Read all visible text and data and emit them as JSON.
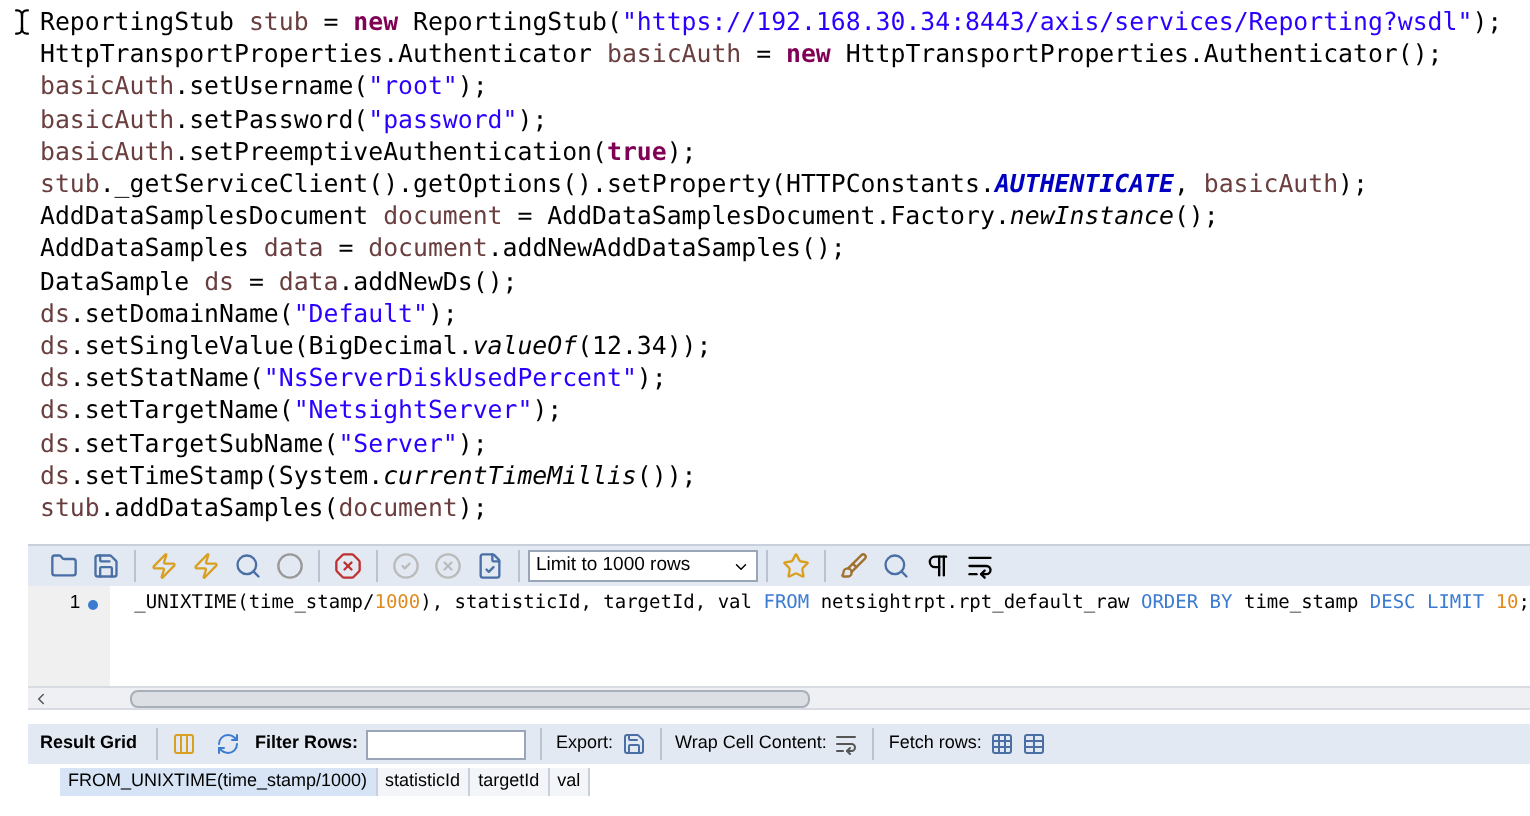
{
  "code_lines": [
    [
      {
        "t": "ReportingStub ",
        "kind": "plain"
      },
      {
        "t": "stub",
        "kind": "var"
      },
      {
        "t": " = ",
        "kind": "plain"
      },
      {
        "t": "new",
        "kind": "kw"
      },
      {
        "t": " ReportingStub(",
        "kind": "plain"
      },
      {
        "t": "\"https://192.168.30.34:8443/axis/services/Reporting?wsdl\"",
        "kind": "str"
      },
      {
        "t": ");",
        "kind": "plain"
      }
    ],
    [
      {
        "t": "HttpTransportProperties.Authenticator ",
        "kind": "plain"
      },
      {
        "t": "basicAuth",
        "kind": "var"
      },
      {
        "t": " = ",
        "kind": "plain"
      },
      {
        "t": "new",
        "kind": "kw"
      },
      {
        "t": " HttpTransportProperties.Authenticator();",
        "kind": "plain"
      }
    ],
    [
      {
        "t": "basicAuth",
        "kind": "var"
      },
      {
        "t": ".setUsername(",
        "kind": "plain"
      },
      {
        "t": "\"root\"",
        "kind": "str"
      },
      {
        "t": ");",
        "kind": "plain"
      }
    ],
    [
      {
        "t": "basicAuth",
        "kind": "var"
      },
      {
        "t": ".setPassword(",
        "kind": "plain"
      },
      {
        "t": "\"password\"",
        "kind": "str"
      },
      {
        "t": ");",
        "kind": "plain"
      }
    ],
    [
      {
        "t": "basicAuth",
        "kind": "var"
      },
      {
        "t": ".setPreemptiveAuthentication(",
        "kind": "plain"
      },
      {
        "t": "true",
        "kind": "kw"
      },
      {
        "t": ");",
        "kind": "plain"
      }
    ],
    [
      {
        "t": "stub",
        "kind": "var"
      },
      {
        "t": "._getServiceClient().getOptions().setProperty(HTTPConstants.",
        "kind": "plain"
      },
      {
        "t": "AUTHENTICATE",
        "kind": "const"
      },
      {
        "t": ", ",
        "kind": "plain"
      },
      {
        "t": "basicAuth",
        "kind": "var"
      },
      {
        "t": ");",
        "kind": "plain"
      }
    ],
    [
      {
        "t": "AddDataSamplesDocument ",
        "kind": "plain"
      },
      {
        "t": "document",
        "kind": "var"
      },
      {
        "t": " = AddDataSamplesDocument.Factory.",
        "kind": "plain"
      },
      {
        "t": "newInstance",
        "kind": "static"
      },
      {
        "t": "();",
        "kind": "plain"
      }
    ],
    [
      {
        "t": "AddDataSamples ",
        "kind": "plain"
      },
      {
        "t": "data",
        "kind": "var"
      },
      {
        "t": " = ",
        "kind": "plain"
      },
      {
        "t": "document",
        "kind": "var"
      },
      {
        "t": ".addNewAddDataSamples();",
        "kind": "plain"
      }
    ],
    [
      {
        "t": "DataSample ",
        "kind": "plain"
      },
      {
        "t": "ds",
        "kind": "var"
      },
      {
        "t": " = ",
        "kind": "plain"
      },
      {
        "t": "data",
        "kind": "var"
      },
      {
        "t": ".addNewDs();",
        "kind": "plain"
      }
    ],
    [
      {
        "t": "ds",
        "kind": "var"
      },
      {
        "t": ".setDomainName(",
        "kind": "plain"
      },
      {
        "t": "\"Default\"",
        "kind": "str"
      },
      {
        "t": ");",
        "kind": "plain"
      }
    ],
    [
      {
        "t": "ds",
        "kind": "var"
      },
      {
        "t": ".setSingleValue(BigDecimal.",
        "kind": "plain"
      },
      {
        "t": "valueOf",
        "kind": "static"
      },
      {
        "t": "(12.34));",
        "kind": "plain"
      }
    ],
    [
      {
        "t": "ds",
        "kind": "var"
      },
      {
        "t": ".setStatName(",
        "kind": "plain"
      },
      {
        "t": "\"NsServerDiskUsedPercent\"",
        "kind": "str"
      },
      {
        "t": ");",
        "kind": "plain"
      }
    ],
    [
      {
        "t": "ds",
        "kind": "var"
      },
      {
        "t": ".setTargetName(",
        "kind": "plain"
      },
      {
        "t": "\"NetsightServer\"",
        "kind": "str"
      },
      {
        "t": ");",
        "kind": "plain"
      }
    ],
    [
      {
        "t": "ds",
        "kind": "var"
      },
      {
        "t": ".setTargetSubName(",
        "kind": "plain"
      },
      {
        "t": "\"Server\"",
        "kind": "str"
      },
      {
        "t": ");",
        "kind": "plain"
      }
    ],
    [
      {
        "t": "ds",
        "kind": "var"
      },
      {
        "t": ".setTimeStamp(System.",
        "kind": "plain"
      },
      {
        "t": "currentTimeMillis",
        "kind": "static"
      },
      {
        "t": "());",
        "kind": "plain"
      }
    ],
    [
      {
        "t": "stub",
        "kind": "var"
      },
      {
        "t": ".addDataSamples(",
        "kind": "plain"
      },
      {
        "t": "document",
        "kind": "var"
      },
      {
        "t": ");",
        "kind": "plain"
      }
    ]
  ],
  "sql_editor": {
    "limit_select": "Limit to 1000 rows",
    "line_number": "1",
    "line": [
      {
        "t": "_UNIXTIME(time_stamp/",
        "kind": "plain"
      },
      {
        "t": "1000",
        "kind": "num"
      },
      {
        "t": "), statisticId, targetId, val ",
        "kind": "plain"
      },
      {
        "t": "FROM",
        "kind": "kw"
      },
      {
        "t": " netsightrpt.rpt_default_raw ",
        "kind": "plain"
      },
      {
        "t": "ORDER BY",
        "kind": "kw"
      },
      {
        "t": " time_stamp ",
        "kind": "plain"
      },
      {
        "t": "DESC LIMIT ",
        "kind": "kw"
      },
      {
        "t": "10",
        "kind": "num"
      },
      {
        "t": ";",
        "kind": "plain"
      }
    ]
  },
  "result_toolbar": {
    "tab": "Result Grid",
    "filter_label": "Filter Rows:",
    "export_label": "Export:",
    "wrap_label": "Wrap Cell Content:",
    "fetch_label": "Fetch rows:"
  },
  "table": {
    "columns": [
      "FROM_UNIXTIME(time_stamp/1000)",
      "statisticId",
      "targetId",
      "val"
    ]
  }
}
